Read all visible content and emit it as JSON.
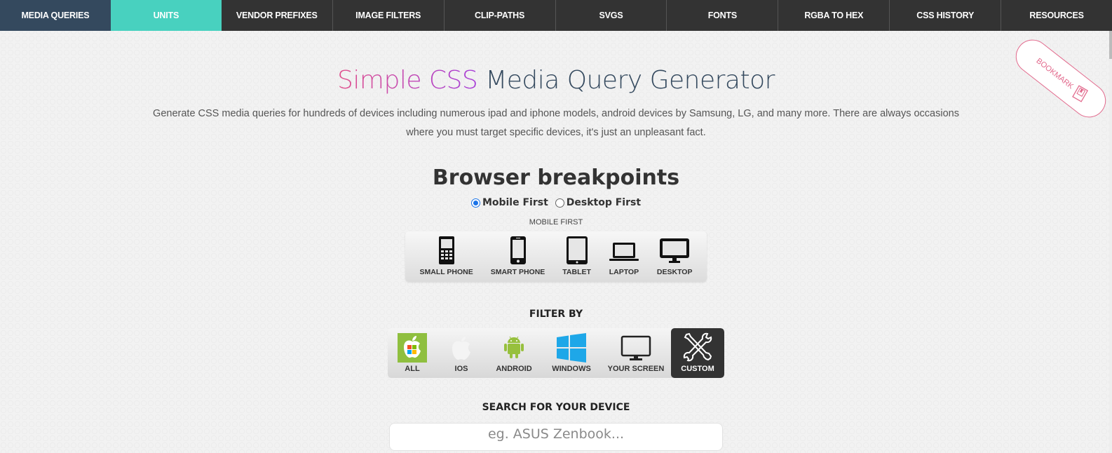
{
  "nav": {
    "items": [
      {
        "label": "MEDIA QUERIES",
        "state": "active"
      },
      {
        "label": "UNITS",
        "state": "highlight"
      },
      {
        "label": "VENDOR PREFIXES"
      },
      {
        "label": "IMAGE FILTERS"
      },
      {
        "label": "CLIP-PATHS"
      },
      {
        "label": "SVGS"
      },
      {
        "label": "FONTS"
      },
      {
        "label": "RGBA TO HEX"
      },
      {
        "label": "CSS HISTORY"
      },
      {
        "label": "RESOURCES"
      }
    ]
  },
  "bookmark": {
    "label": "BOOKMARK",
    "color": "#e26a8d"
  },
  "header": {
    "title_accent": "Simple CSS",
    "title_rest": " Media Query Generator",
    "intro": "Generate CSS media queries for hundreds of devices including numerous ipad and iphone models, android devices by Samsung, LG, and many more. There are always occasions where you must target specific devices, it's just an unpleasant fact."
  },
  "breakpoints": {
    "title": "Browser breakpoints",
    "options": [
      {
        "label": "Mobile First",
        "checked": true
      },
      {
        "label": "Desktop First",
        "checked": false
      }
    ],
    "mode_label": "MOBILE FIRST",
    "devices": [
      {
        "label": "SMALL PHONE",
        "icon": "feature-phone-icon"
      },
      {
        "label": "SMART PHONE",
        "icon": "smartphone-icon"
      },
      {
        "label": "TABLET",
        "icon": "tablet-icon"
      },
      {
        "label": "LAPTOP",
        "icon": "laptop-icon"
      },
      {
        "label": "DESKTOP",
        "icon": "desktop-icon"
      }
    ]
  },
  "filter": {
    "title": "FILTER BY",
    "items": [
      {
        "label": "ALL",
        "icon": "apple-windows-icon"
      },
      {
        "label": "IOS",
        "icon": "apple-icon"
      },
      {
        "label": "ANDROID",
        "icon": "android-icon"
      },
      {
        "label": "WINDOWS",
        "icon": "windows-icon"
      },
      {
        "label": "YOUR SCREEN",
        "icon": "monitor-icon"
      },
      {
        "label": "CUSTOM",
        "icon": "tools-icon",
        "active": true
      }
    ]
  },
  "search": {
    "title": "SEARCH FOR YOUR DEVICE",
    "placeholder": "eg. ASUS Zenbook...",
    "value": ""
  },
  "colors": {
    "nav_active": "#34495e",
    "nav_units": "#48d1bf",
    "nav_bg": "#333333",
    "title_rest": "#34495e",
    "android_green": "#97c03d",
    "windows_blue": "#1ea7e8"
  }
}
